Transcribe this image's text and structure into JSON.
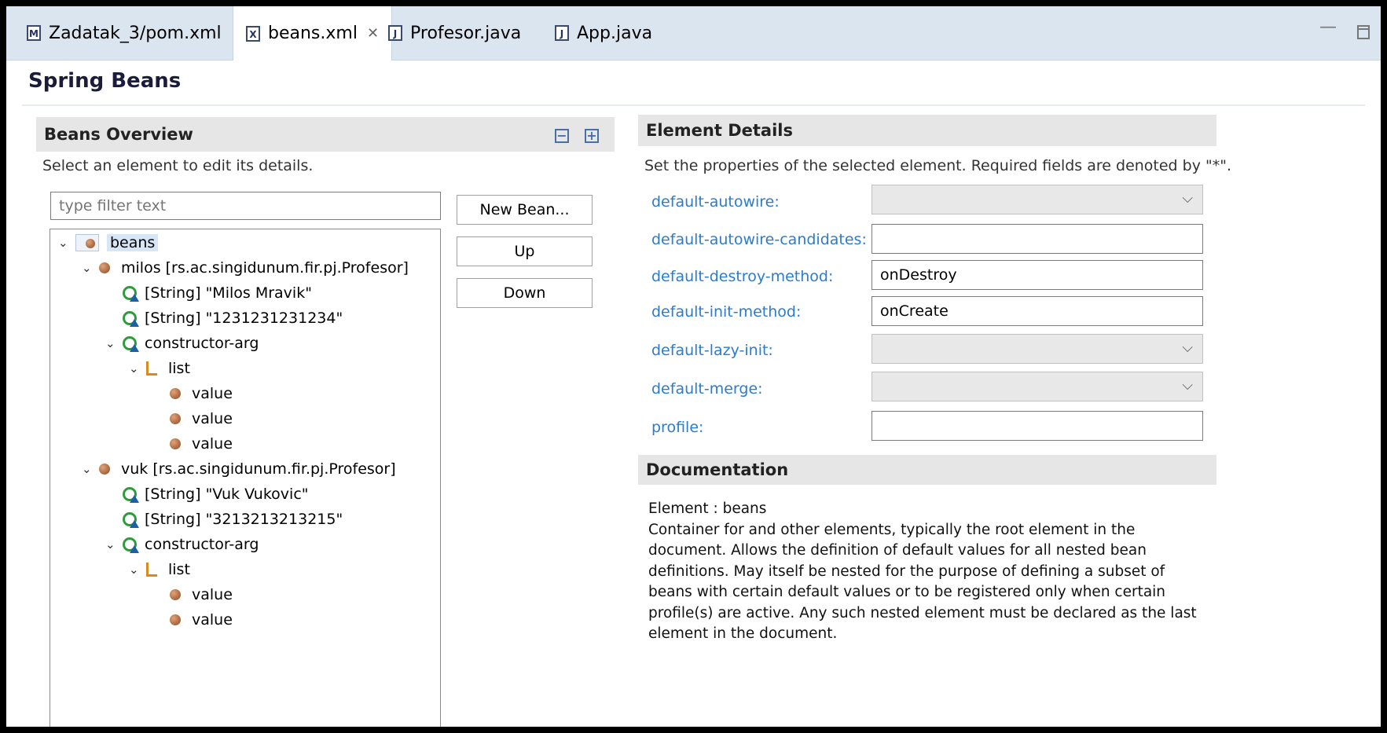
{
  "tabs": [
    {
      "label": "Zadatak_3/pom.xml",
      "icon": "maven-pom-icon",
      "icon_glyph": "M"
    },
    {
      "label": "beans.xml",
      "icon": "xml-file-icon",
      "icon_glyph": "X",
      "close": "✕"
    },
    {
      "label": "Profesor.java",
      "icon": "java-file-icon",
      "icon_glyph": "J"
    },
    {
      "label": "App.java",
      "icon": "java-file-icon",
      "icon_glyph": "J"
    }
  ],
  "window": {
    "minimize": "▭"
  },
  "page_title": "Spring Beans",
  "overview": {
    "title": "Beans Overview",
    "description": "Select an element to edit its details.",
    "filter_placeholder": "type filter text",
    "tree": [
      {
        "label": "beans",
        "depth": 0,
        "expanded": true,
        "icon": "beans-icon",
        "selected": true
      },
      {
        "label": "milos [rs.ac.singidunum.fir.pj.Profesor]",
        "depth": 1,
        "expanded": true,
        "icon": "bean-icon"
      },
      {
        "label": "[String] \"Milos Mravik\"",
        "depth": 2,
        "icon": "constructor-arg-icon"
      },
      {
        "label": "[String] \"1231231231234\"",
        "depth": 2,
        "icon": "constructor-arg-icon"
      },
      {
        "label": "constructor-arg",
        "depth": 2,
        "expanded": true,
        "icon": "constructor-arg-icon"
      },
      {
        "label": "list",
        "depth": 3,
        "expanded": true,
        "icon": "list-icon"
      },
      {
        "label": "value",
        "depth": 4,
        "icon": "bean-icon"
      },
      {
        "label": "value",
        "depth": 4,
        "icon": "bean-icon"
      },
      {
        "label": "value",
        "depth": 4,
        "icon": "bean-icon"
      },
      {
        "label": "vuk [rs.ac.singidunum.fir.pj.Profesor]",
        "depth": 1,
        "expanded": true,
        "icon": "bean-icon"
      },
      {
        "label": "[String] \"Vuk Vukovic\"",
        "depth": 2,
        "icon": "constructor-arg-icon"
      },
      {
        "label": "[String] \"3213213213215\"",
        "depth": 2,
        "icon": "constructor-arg-icon"
      },
      {
        "label": "constructor-arg",
        "depth": 2,
        "expanded": true,
        "icon": "constructor-arg-icon"
      },
      {
        "label": "list",
        "depth": 3,
        "expanded": true,
        "icon": "list-icon"
      },
      {
        "label": "value",
        "depth": 4,
        "icon": "bean-icon"
      },
      {
        "label": "value",
        "depth": 4,
        "icon": "bean-icon"
      }
    ],
    "buttons": {
      "new_bean": "New Bean...",
      "up": "Up",
      "down": "Down"
    }
  },
  "details": {
    "title": "Element Details",
    "description": "Set the properties of the selected element. Required fields are denoted by \"*\".",
    "fields": [
      {
        "label": "default-autowire:",
        "type": "combo",
        "value": ""
      },
      {
        "label": "default-autowire-candidates:",
        "type": "text",
        "value": ""
      },
      {
        "label": "default-destroy-method:",
        "type": "text",
        "value": "onDestroy"
      },
      {
        "label": "default-init-method:",
        "type": "text",
        "value": "onCreate"
      },
      {
        "label": "default-lazy-init:",
        "type": "combo",
        "value": ""
      },
      {
        "label": "default-merge:",
        "type": "combo",
        "value": ""
      },
      {
        "label": "profile:",
        "type": "text",
        "value": ""
      }
    ]
  },
  "documentation": {
    "title": "Documentation",
    "element_line": "Element : beans",
    "body": "Container for and other elements, typically the root element in the document. Allows the definition of default values for all nested bean definitions. May itself be nested for the purpose of defining a subset of beans with certain default values or to be registered only when certain profile(s) are active. Any such nested element must be declared as the last element in the document."
  },
  "colors": {
    "link": "#2b7bd0",
    "tabbar": "#dae5f0",
    "header": "#e6e6e6",
    "selection": "#d7e6f7"
  }
}
